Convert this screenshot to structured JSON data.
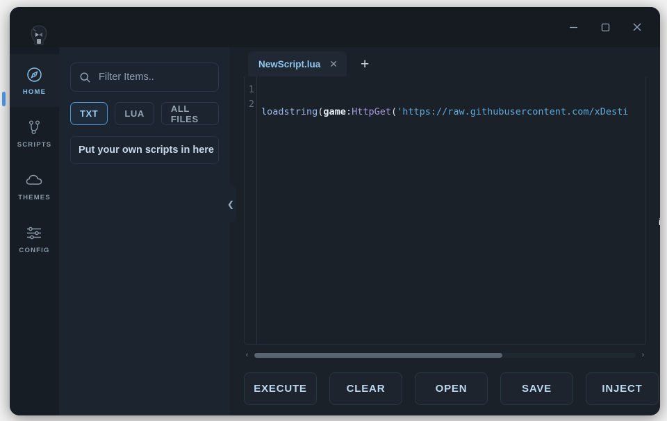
{
  "window": {
    "controls": {
      "minimize": "minimize-icon",
      "maximize": "maximize-icon",
      "close": "close-icon"
    },
    "logo": "skull-mask-logo"
  },
  "sidebar": {
    "items": [
      {
        "label": "HOME",
        "icon": "compass-icon",
        "active": true
      },
      {
        "label": "SCRIPTS",
        "icon": "git-branch-icon",
        "active": false
      },
      {
        "label": "THEMES",
        "icon": "cloud-icon",
        "active": false
      },
      {
        "label": "CONFIG",
        "icon": "sliders-icon",
        "active": false
      }
    ]
  },
  "scripts_panel": {
    "filter": {
      "icon": "search-icon",
      "value": "",
      "placeholder": "Filter Items.."
    },
    "chips": [
      {
        "label": "TXT",
        "active": true
      },
      {
        "label": "LUA",
        "active": false
      },
      {
        "label": "ALL FILES",
        "active": false
      }
    ],
    "items": [
      {
        "label": "Put your own scripts in here"
      }
    ],
    "collapse_handle": "chevron-left-icon"
  },
  "editor": {
    "tabs": [
      {
        "label": "NewScript.lua",
        "close_icon": "close-icon",
        "active": true
      }
    ],
    "new_tab_label": "+",
    "line_numbers": [
      "1",
      "2"
    ],
    "code": {
      "line1": {
        "fn": "loadstring",
        "open_paren": "(",
        "obj": "game",
        "colon": ":",
        "method": "HttpGet",
        "open_paren2": "(",
        "string": "'https://raw.githubusercontent.com/xDesti"
      },
      "line2": ""
    },
    "scrollbar": {
      "left_arrow": "‹",
      "right_arrow": "›",
      "thumb_percent": 65
    }
  },
  "actions": {
    "buttons": [
      {
        "label": "EXECUTE"
      },
      {
        "label": "CLEAR"
      },
      {
        "label": "OPEN"
      },
      {
        "label": "SAVE"
      }
    ],
    "inject": {
      "label": "INJECT"
    }
  },
  "stray_glyph": "i",
  "colors": {
    "page_background": "#f2f2f2",
    "window_background": "#1b2129",
    "titlebar": "#161b22",
    "sidebar": "#171d25",
    "panel": "#1c2430",
    "accent": "#86c0e8",
    "chip_active_border": "#4b90cf",
    "muted_text": "#8b9aa8"
  }
}
